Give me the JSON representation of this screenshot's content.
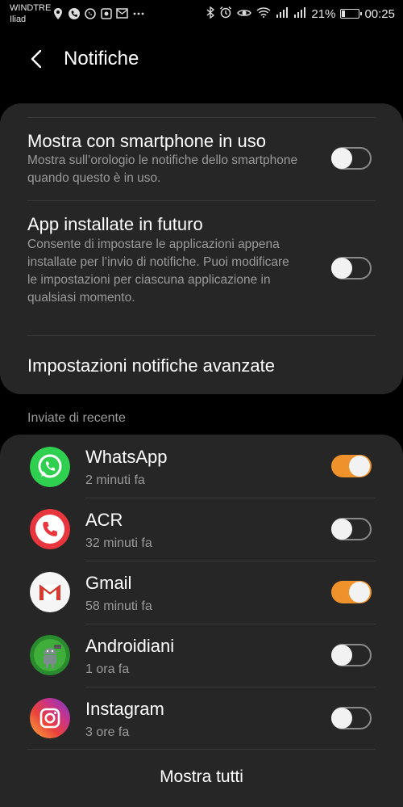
{
  "status_bar": {
    "carrier_1": "WINDTRE",
    "carrier_2": "Iliad",
    "battery_percent": "21%",
    "battery_level": 0.21,
    "time": "00:25",
    "icons_left": [
      "location-icon",
      "phone-call-icon",
      "whatsapp-icon",
      "recorder-icon",
      "mail-icon",
      "more-icon"
    ],
    "icons_right": [
      "bluetooth-icon",
      "alarm-icon",
      "eye-comfort-icon",
      "wifi-icon",
      "signal-icon",
      "signal-icon"
    ]
  },
  "header": {
    "title": "Notifiche"
  },
  "settings": [
    {
      "title": "Mostra con smartphone in uso",
      "description": "Mostra sull’orologio le notifiche dello smartphone quando questo è in uso.",
      "enabled": false
    },
    {
      "title": "App installate in futuro",
      "description": "Consente di impostare le applicazioni appena installate per l’invio di notifiche. Puoi modificare le impostazioni per ciascuna applicazione in qualsiasi momento.",
      "enabled": false
    },
    {
      "title": "Impostazioni notifiche avanzate"
    }
  ],
  "recent": {
    "header": "Inviate di recente",
    "apps": [
      {
        "name": "WhatsApp",
        "time": "2 minuti fa",
        "enabled": true,
        "icon": "whatsapp-icon"
      },
      {
        "name": "ACR",
        "time": "32 minuti fa",
        "enabled": false,
        "icon": "acr-icon"
      },
      {
        "name": "Gmail",
        "time": "58 minuti fa",
        "enabled": true,
        "icon": "gmail-icon"
      },
      {
        "name": "Androidiani",
        "time": "1 ora fa",
        "enabled": false,
        "icon": "androidiani-icon"
      },
      {
        "name": "Instagram",
        "time": "3 ore fa",
        "enabled": false,
        "icon": "instagram-icon"
      }
    ],
    "show_all": "Mostra tutti"
  },
  "colors": {
    "accent": "#f0922b",
    "card": "#262626",
    "background": "#000000",
    "secondary_text": "#9a9a9a"
  }
}
